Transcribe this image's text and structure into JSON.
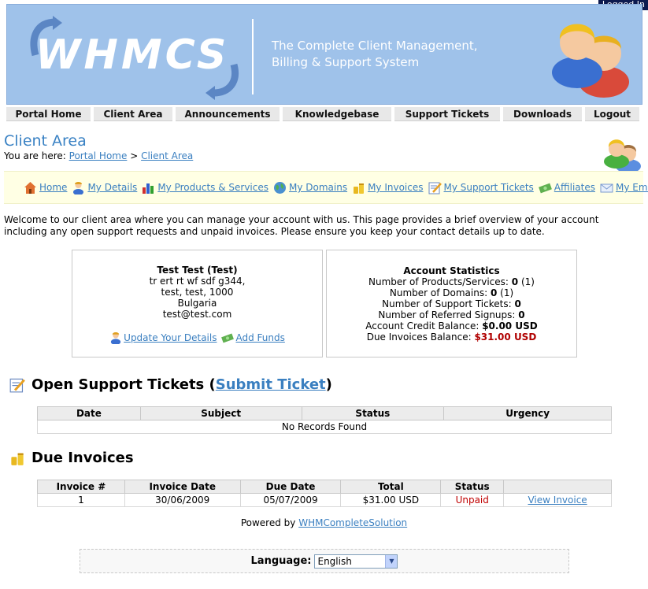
{
  "status": {
    "logged_in": "Logged In"
  },
  "header": {
    "logo": "WHMCS",
    "tagline_line1": "The Complete Client Management,",
    "tagline_line2": "Billing & Support System"
  },
  "topnav": [
    "Portal Home",
    "Client Area",
    "Announcements",
    "Knowledgebase",
    "Support Tickets",
    "Downloads",
    "Logout"
  ],
  "page": {
    "title": "Client Area",
    "breadcrumb_prefix": "You are here:",
    "crumb1": "Portal Home",
    "crumb_sep": ">",
    "crumb2": "Client Area"
  },
  "menu": [
    {
      "label": "Home",
      "icon": "home-icon"
    },
    {
      "label": "My Details",
      "icon": "person-icon"
    },
    {
      "label": "My Products & Services",
      "icon": "bar-chart-icon"
    },
    {
      "label": "My Domains",
      "icon": "globe-icon"
    },
    {
      "label": "My Invoices",
      "icon": "coins-icon"
    },
    {
      "label": "My Support Tickets",
      "icon": "note-edit-icon"
    },
    {
      "label": "Affiliates",
      "icon": "money-icon"
    },
    {
      "label": "My Emails",
      "icon": "envelope-icon"
    }
  ],
  "welcome": "Welcome to our client area where you can manage your account with us. This page provides a brief overview of your account including any open support requests and unpaid invoices. Please ensure you keep your contact details up to date.",
  "client": {
    "name": "Test Test (Test)",
    "address1": "tr ert rt wf sdf g344,",
    "address2": "test, test, 1000",
    "country": "Bulgaria",
    "email": "test@test.com",
    "update_link": "Update Your Details",
    "funds_link": "Add Funds"
  },
  "stats": {
    "title": "Account Statistics",
    "products_label": "Number of Products/Services:",
    "products_value": "0",
    "products_total": "(1)",
    "domains_label": "Number of Domains:",
    "domains_value": "0",
    "domains_total": "(1)",
    "tickets_label": "Number of Support Tickets:",
    "tickets_value": "0",
    "referred_label": "Number of Referred Signups:",
    "referred_value": "0",
    "credit_label": "Account Credit Balance:",
    "credit_value": "$0.00 USD",
    "due_label": "Due Invoices Balance:",
    "due_value": "$31.00 USD"
  },
  "tickets": {
    "heading": "Open Support Tickets (",
    "heading_link": "Submit Ticket",
    "heading_end": ")",
    "columns": [
      "Date",
      "Subject",
      "Status",
      "Urgency"
    ],
    "empty": "No Records Found"
  },
  "invoices": {
    "heading": "Due Invoices",
    "columns": [
      "Invoice #",
      "Invoice Date",
      "Due Date",
      "Total",
      "Status",
      ""
    ],
    "rows": [
      {
        "num": "1",
        "date": "30/06/2009",
        "due": "05/07/2009",
        "total": "$31.00 USD",
        "status": "Unpaid",
        "action": "View Invoice"
      }
    ]
  },
  "footer": {
    "powered_prefix": "Powered by",
    "powered_link": "WHMCompleteSolution",
    "language_label": "Language:",
    "language_value": "English"
  },
  "colors": {
    "banner": "#9fc2ea",
    "link": "#3a7fc0",
    "due": "#b00000"
  }
}
